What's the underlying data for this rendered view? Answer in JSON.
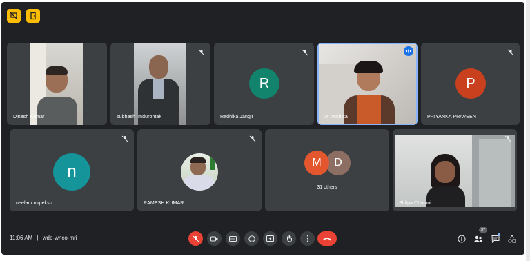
{
  "meeting": {
    "time": "11:06 AM",
    "separator": "|",
    "code": "wdo-wnco-mri"
  },
  "participants": {
    "dinesh": {
      "name": "Dinesh Kumar"
    },
    "subhash": {
      "name": "subhash_mdurohtak"
    },
    "radhika": {
      "name": "Radhika Jangir",
      "initial": "R",
      "color": "#12836d"
    },
    "anshika": {
      "name": "Dr Anshika"
    },
    "priyanka": {
      "name": "PRIYANKA PRAVEEN",
      "initial": "P",
      "color": "#c9401e"
    },
    "neelam": {
      "name": "neelam nirpeksh",
      "initial": "n",
      "color": "#15959a"
    },
    "ramesh": {
      "name": "RAMESH KUMAR"
    },
    "others": {
      "label": "31 others",
      "initial_1": "M",
      "color_1": "#e4572e",
      "initial_2": "D",
      "color_2": "#8d6e63"
    },
    "shilpa": {
      "name": "Shilpa Chutani"
    }
  },
  "people_count": "37",
  "colors": {
    "background": "#202124",
    "tile": "#3c4043",
    "accent_yellow": "#fbbc04",
    "end_call_red": "#ea4335",
    "active_blue": "#8ab4f8"
  }
}
